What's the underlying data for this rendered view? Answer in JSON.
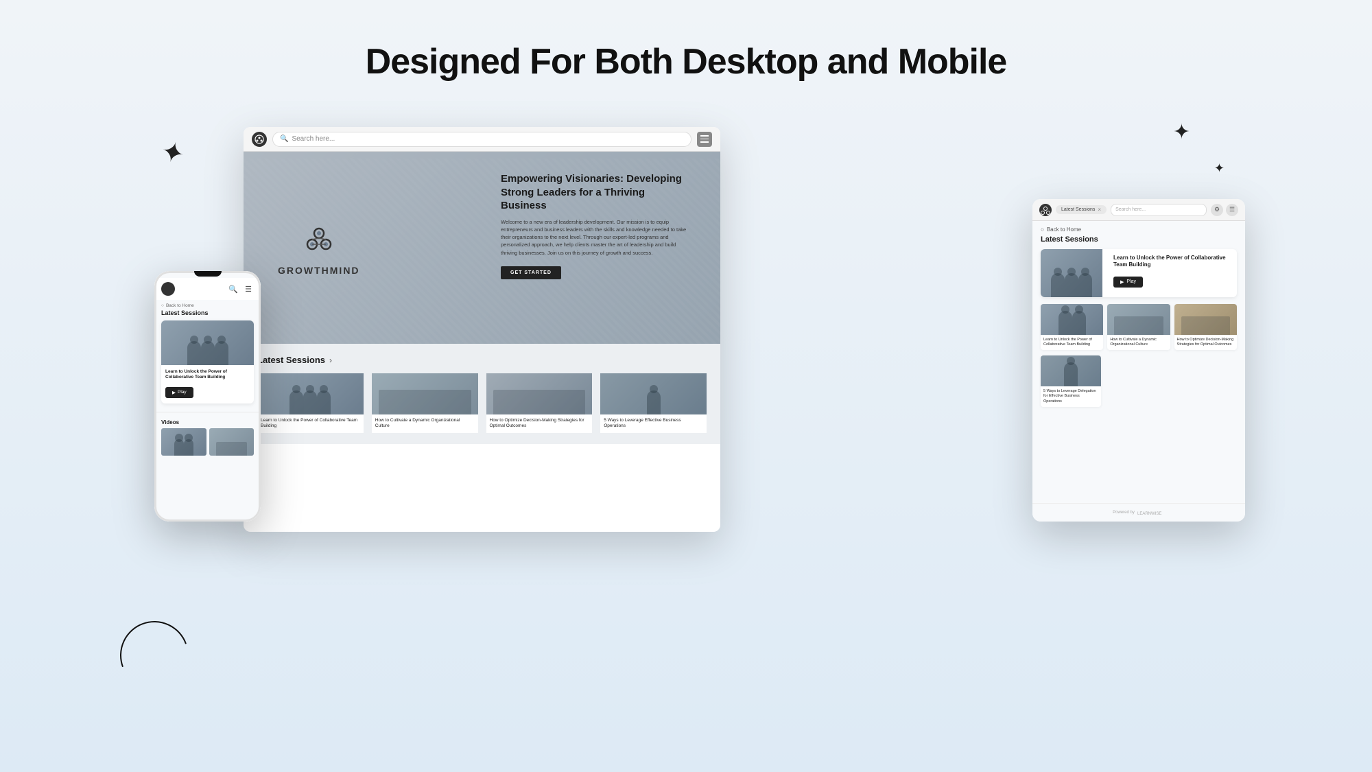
{
  "page": {
    "title": "Designed For Both Desktop and Mobile",
    "background": "linear-gradient(180deg, #f0f4f8 0%, #ddeaf5 100%)"
  },
  "desktop": {
    "search_placeholder": "Search here...",
    "hero": {
      "brand": "GROWTHMIND",
      "heading": "Empowering Visionaries: Developing Strong Leaders for a Thriving Business",
      "body": "Welcome to a new era of leadership development. Our mission is to equip entrepreneurs and business leaders with the skills and knowledge needed to take their organizations to the next level. Through our expert-led programs and personalized approach, we help clients master the art of leadership and build thriving businesses. Join us on this journey of growth and success.",
      "cta": "GET STARTED"
    },
    "latest_sessions": {
      "title": "Latest Sessions",
      "sessions": [
        {
          "label": "Learn to Unlock the Power of Collaborative Team Building"
        },
        {
          "label": "How to Cultivate a Dynamic Organizational Culture"
        },
        {
          "label": "How to Optimize Decision-Making Strategies for Optimal Outcomes"
        },
        {
          "label": "5 Ways to Leverage Effective Business Operations"
        }
      ]
    }
  },
  "tablet": {
    "search_chip": "Latest Sessions",
    "search_placeholder": "Search here...",
    "back_label": "Back to Home",
    "section_title": "Latest Sessions",
    "featured": {
      "title": "Learn to Unlock the Power of Collaborative Team Building",
      "play_label": "Play"
    },
    "grid": [
      {
        "label": "Learn to Unlock the Power of Collaborative Team Building"
      },
      {
        "label": "How to Cultivate a Dynamic Organizational Culture"
      },
      {
        "label": "How to Optimize Decision-Making Strategies for Optimal Outcomes"
      },
      {
        "label": "5 Ways to Leverage Delegation for Effective Business Operations"
      }
    ],
    "footer": "Powered by"
  },
  "mobile": {
    "back_label": "Back to Home",
    "section_title": "Latest Sessions",
    "featured": {
      "title": "Learn to Unlock the Power of Collaborative Team Building",
      "play_label": "Play"
    },
    "videos_title": "Videos"
  }
}
